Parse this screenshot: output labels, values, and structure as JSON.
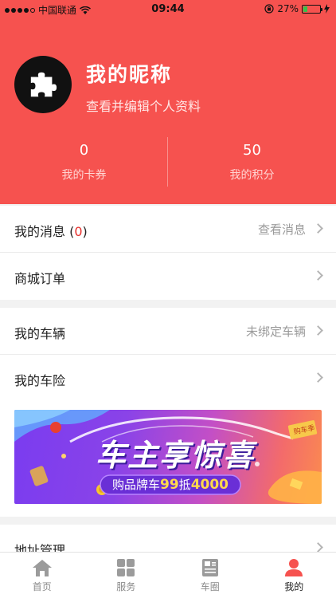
{
  "status_bar": {
    "carrier": "中国联通",
    "time": "09:44",
    "battery_percent": "27%",
    "battery_level": 0.27,
    "battery_color": "#36c34a"
  },
  "profile": {
    "nickname": "我的昵称",
    "edit_link": "查看并编辑个人资料",
    "avatar_icon": "puzzle-piece-icon",
    "stats": [
      {
        "value": "0",
        "label": "我的卡券"
      },
      {
        "value": "50",
        "label": "我的积分"
      }
    ]
  },
  "menu": {
    "messages": {
      "label_prefix": "我的消息 (",
      "count": "0",
      "label_suffix": ")",
      "right": "查看消息"
    },
    "orders": {
      "label": "商城订单"
    },
    "vehicles": {
      "label": "我的车辆",
      "right": "未绑定车辆"
    },
    "insurance": {
      "label": "我的车险"
    },
    "address": {
      "label": "地址管理"
    }
  },
  "banner": {
    "headline": "车主享惊喜",
    "subline_prefix": "购品牌车",
    "subline_amount": "99",
    "subline_middle": "抵",
    "subline_value": "4000",
    "tag": "购车季"
  },
  "tabbar": {
    "tabs": [
      {
        "label": "首页",
        "icon": "home-icon"
      },
      {
        "label": "服务",
        "icon": "grid-icon"
      },
      {
        "label": "车圈",
        "icon": "news-icon"
      },
      {
        "label": "我的",
        "icon": "person-icon"
      }
    ],
    "active_index": 3,
    "accent_color": "#f6524f"
  },
  "colors": {
    "header_bg": "#f6524f",
    "page_bg": "#f2f2f2"
  }
}
